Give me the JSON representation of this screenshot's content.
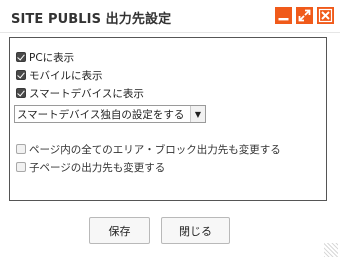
{
  "window": {
    "title": "SITE PUBLIS 出力先設定",
    "accent_color": "#f05a1a",
    "controls": [
      "minimize-icon",
      "maximize-icon",
      "close-icon"
    ]
  },
  "options": {
    "pc": {
      "label": "PCに表示",
      "checked": true
    },
    "mobile": {
      "label": "モバイルに表示",
      "checked": true
    },
    "smart": {
      "label": "スマートデバイスに表示",
      "checked": true
    },
    "smart_mode": {
      "selected": "スマートデバイス独自の設定をする"
    },
    "change_all": {
      "label": "ページ内の全てのエリア・ブロック出力先も変更する",
      "checked": false
    },
    "change_children": {
      "label": "子ページの出力先も変更する",
      "checked": false
    }
  },
  "buttons": {
    "save": "保存",
    "close": "閉じる"
  }
}
